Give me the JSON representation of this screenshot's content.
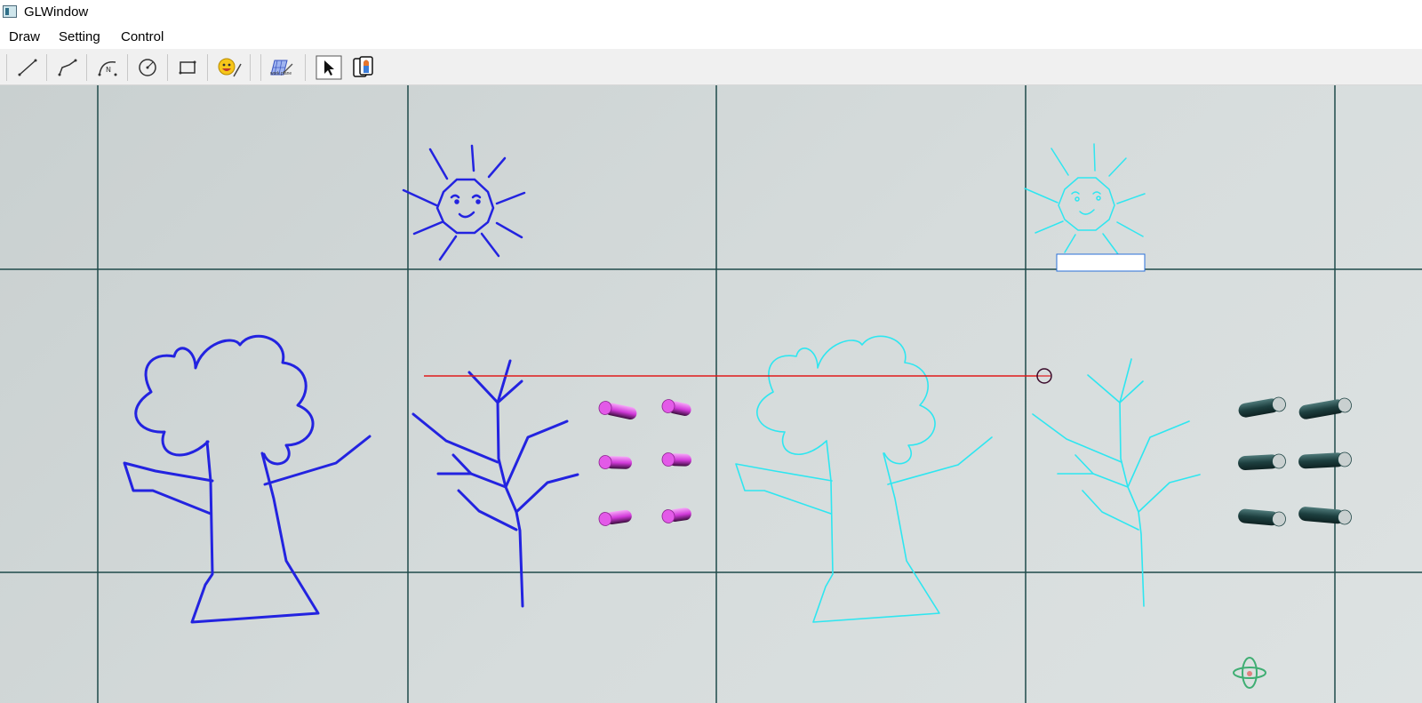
{
  "window": {
    "title": "GLWindow"
  },
  "menu": {
    "items": [
      "Draw",
      "Setting",
      "Control"
    ]
  },
  "toolbar": {
    "tools": [
      {
        "icon": "line-tool-icon"
      },
      {
        "icon": "polyline-tool-icon"
      },
      {
        "icon": "curve-tool-icon"
      },
      {
        "icon": "circle-tool-icon"
      },
      {
        "icon": "rectangle-tool-icon"
      },
      {
        "icon": "emoji-tool-icon"
      },
      {
        "icon": "work-plane-icon",
        "label": "work plane"
      },
      {
        "icon": "select-arrow-icon"
      },
      {
        "icon": "color-tool-icon"
      }
    ]
  },
  "colors": {
    "grid": "#1f4a4a",
    "blue_drawing": "#2323e0",
    "cyan_drawing": "#2ee6f0",
    "red_line": "#e01a1a",
    "magenta_cylinder": "#e040e8",
    "dark_cylinder": "#1f4545"
  }
}
